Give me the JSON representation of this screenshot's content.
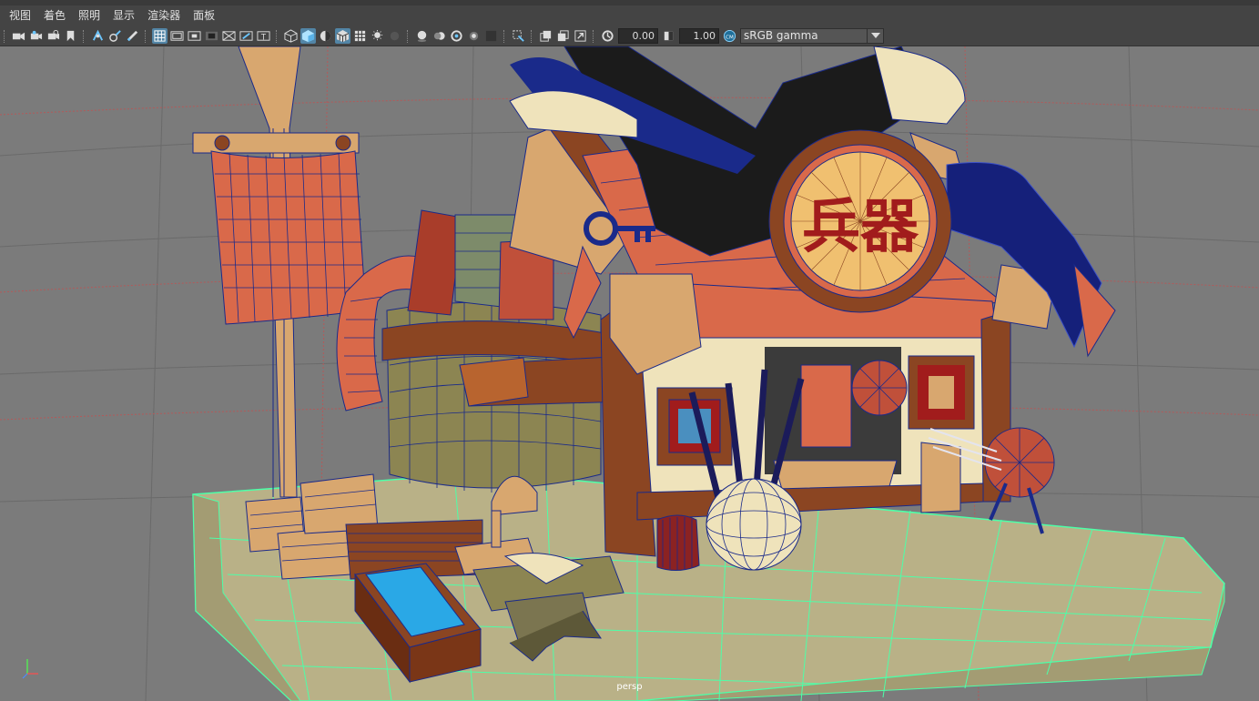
{
  "menu": [
    "视图",
    "着色",
    "照明",
    "显示",
    "渲染器",
    "面板"
  ],
  "toolbar": {
    "exposure_value": "0.00",
    "gamma_value": "1.00",
    "color_management_label": "sRGB gamma",
    "icons": [
      "select-camera-icon",
      "camera-attributes-icon",
      "bookmarks-icon",
      "image-plane-icon",
      "2d-pan-zoom-icon",
      "grease-pencil-icon",
      "grid-icon",
      "film-gate-icon",
      "resolution-gate-icon",
      "gate-mask-icon",
      "field-chart-icon",
      "safe-action-icon",
      "safe-title-icon",
      "wireframe-icon",
      "smooth-shade-icon",
      "textured-icon",
      "wireframe-on-shaded-icon",
      "xray-icon",
      "use-all-lights-icon",
      "shadows-icon",
      "screen-space-ao-icon",
      "motion-blur-icon",
      "anti-aliasing-icon",
      "depth-of-field-icon",
      "isolate-select-icon",
      "xray-joints-icon",
      "xray-active-icon",
      "exposure-icon",
      "gamma-icon",
      "color-management-icon"
    ]
  },
  "viewport": {
    "camera": "persp",
    "sign_text": "兵器",
    "colors": {
      "background": "#7b7b7b",
      "wire": "#1a2a8a",
      "floor_wire": "#4dffa8",
      "floor": "#b9b187",
      "roof": "#d9694a",
      "wall": "#efe3bb",
      "wood_light": "#d8a76f",
      "wood_dark": "#8b4522",
      "brick": "#8c8552",
      "sign_red": "#a11c1c"
    }
  }
}
